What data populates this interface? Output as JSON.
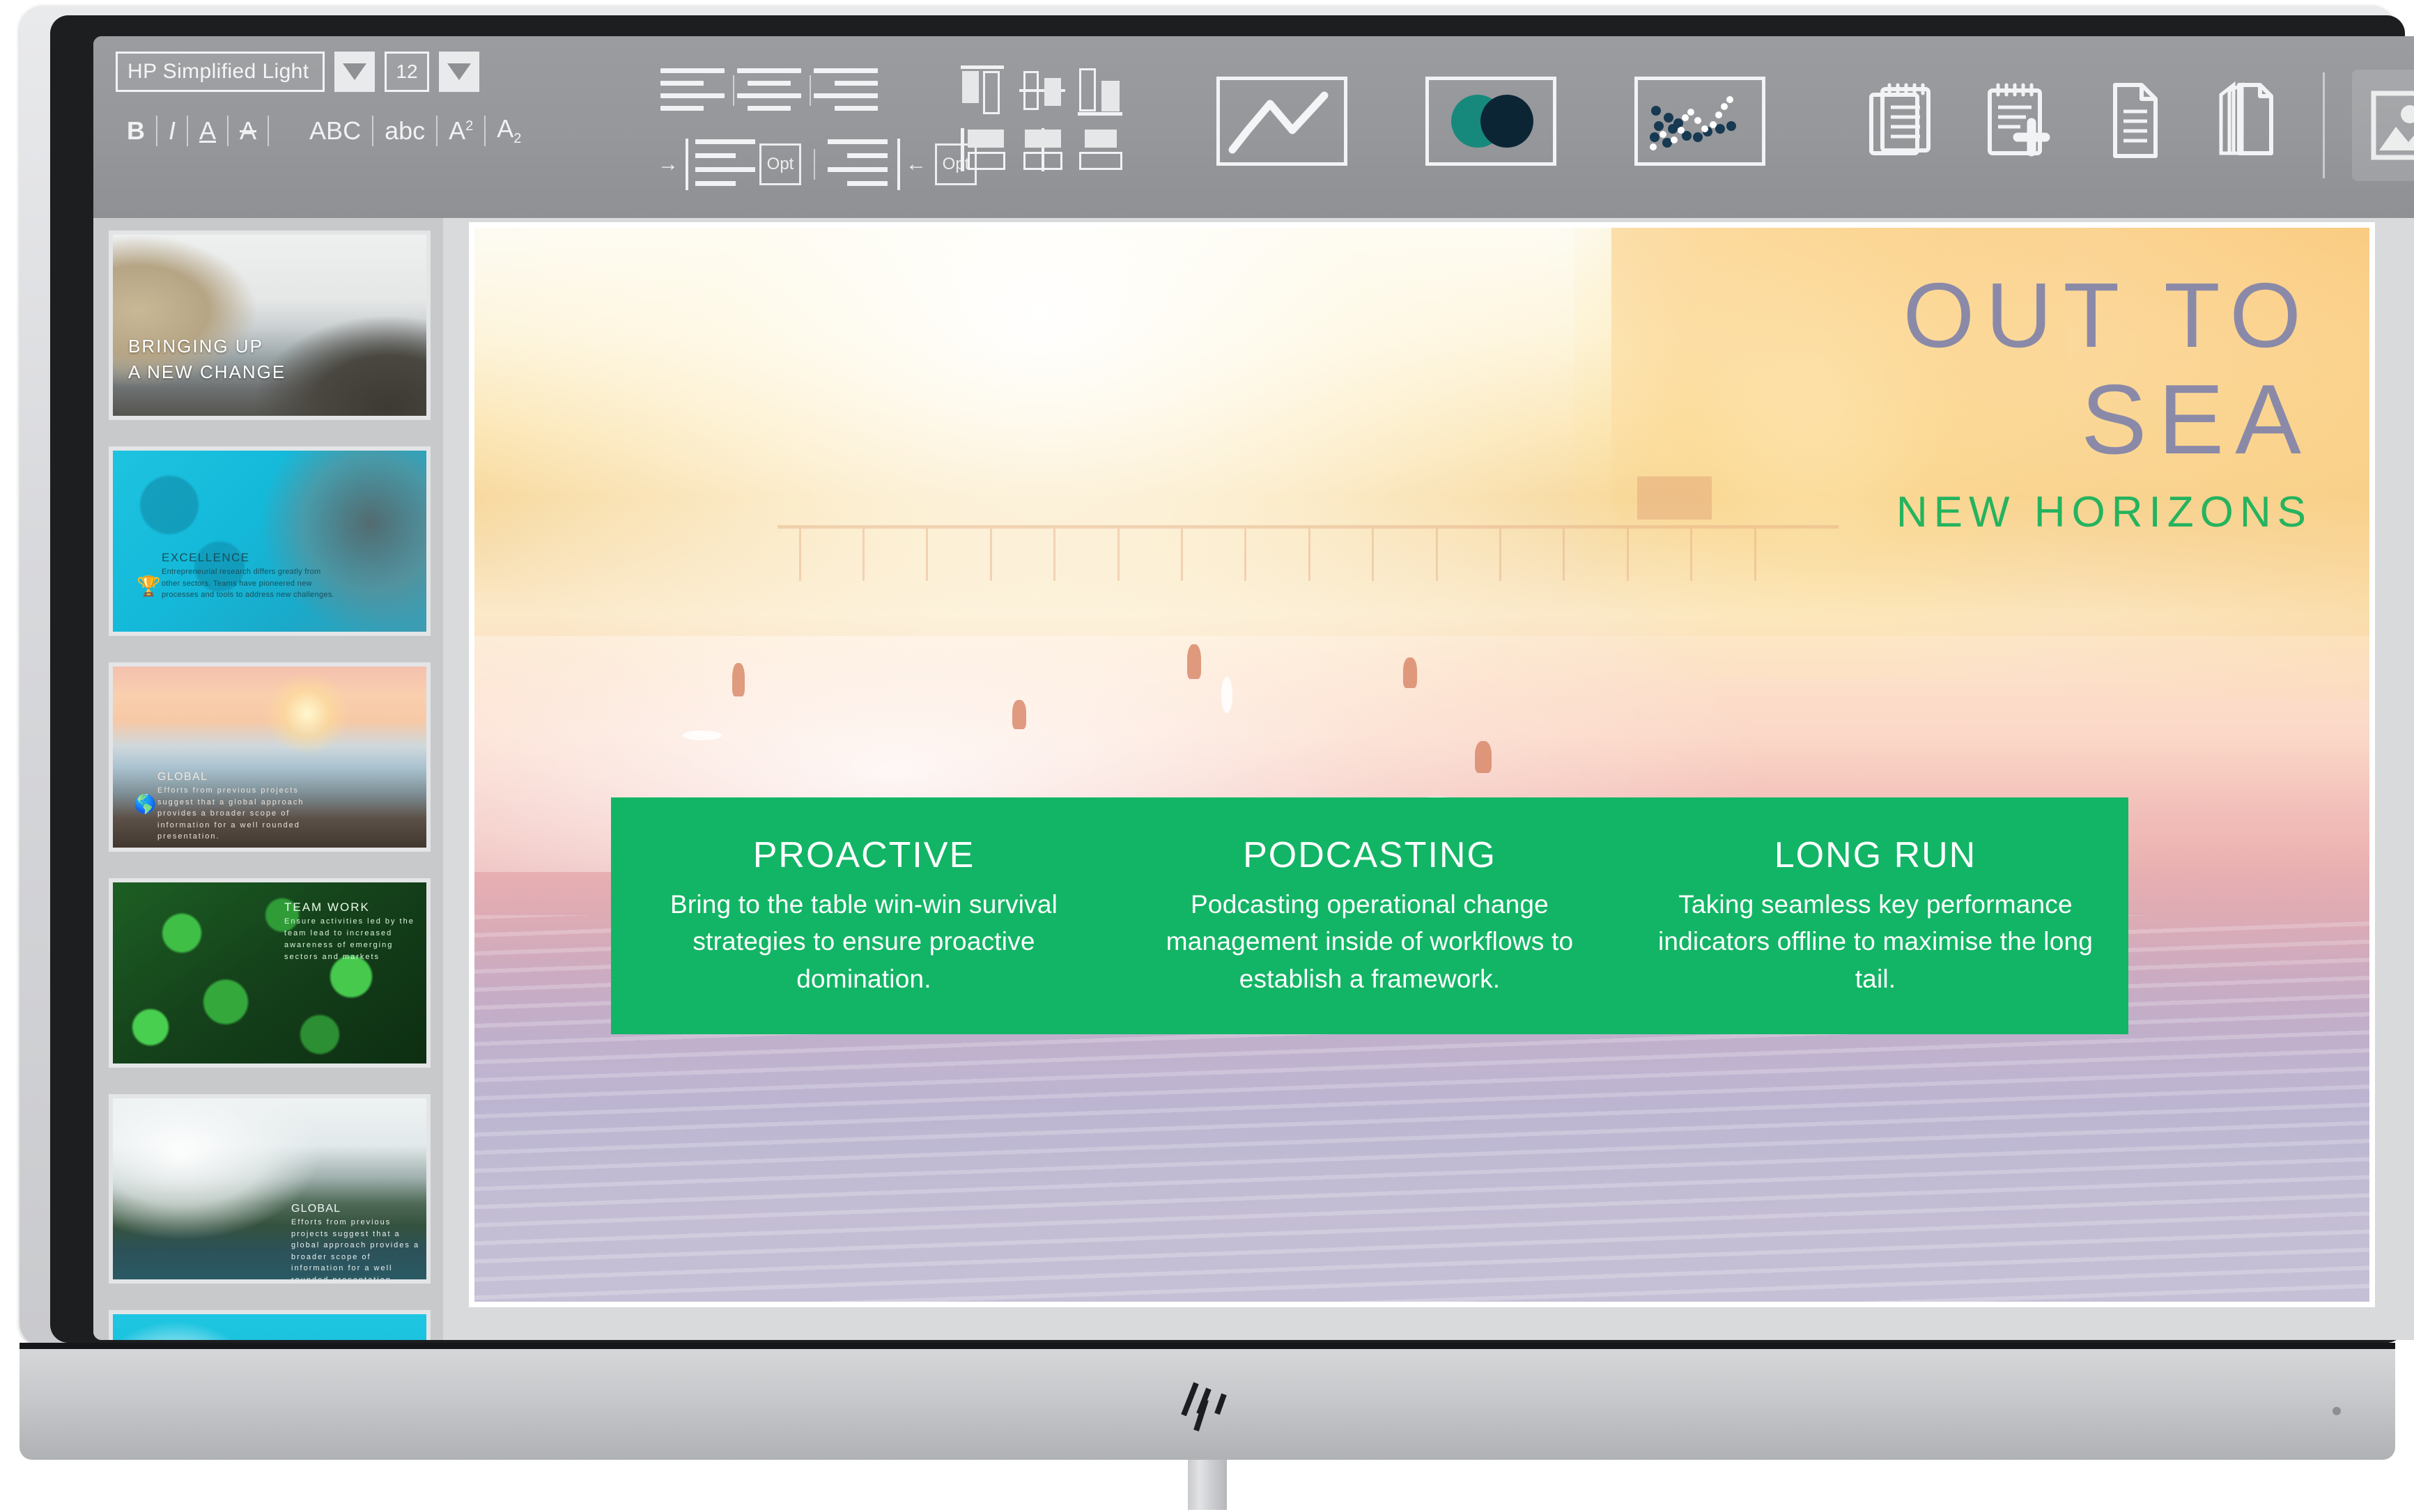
{
  "toolbar": {
    "font": {
      "name_value": "HP Simplified Light",
      "size_value": "12",
      "dropdown_icon": "chevron-down-icon"
    },
    "format_buttons": [
      {
        "label": "B",
        "name": "bold-button"
      },
      {
        "label": "I",
        "name": "italic-button"
      },
      {
        "label": "A",
        "name": "underline-button"
      },
      {
        "label": "A",
        "name": "strikethrough-button"
      },
      {
        "label": "ABC",
        "name": "uppercase-button"
      },
      {
        "label": "abc",
        "name": "lowercase-button"
      },
      {
        "label": "A",
        "sup": "2",
        "name": "superscript-button"
      },
      {
        "label": "A",
        "sub": "2",
        "name": "subscript-button"
      }
    ],
    "paragraph": {
      "align_left": "align-left-icon",
      "align_center": "align-center-icon",
      "align_right": "align-right-icon",
      "indent_increase": "indent-increase-icon",
      "indent_decrease": "indent-decrease-icon",
      "opt_label": "Opt"
    },
    "arrange": {
      "align_top": "align-top-icon",
      "align_middle": "align-middle-icon",
      "align_bottom": "align-bottom-icon",
      "distribute_left": "distribute-left-icon",
      "distribute_center": "distribute-center-icon",
      "distribute_right": "distribute-right-icon"
    },
    "insert_tools": [
      {
        "name": "line-chart-icon",
        "label": "Line chart"
      },
      {
        "name": "venn-circles-icon",
        "label": "Overlapping circles"
      },
      {
        "name": "scatter-plot-icon",
        "label": "Scatter plot"
      }
    ],
    "doc_tools": [
      {
        "name": "notepad-icon",
        "label": "Notes"
      },
      {
        "name": "notepad-add-icon",
        "label": "Add note"
      },
      {
        "name": "document-icon",
        "label": "Document"
      },
      {
        "name": "copy-pages-icon",
        "label": "Duplicate"
      }
    ],
    "image_tool": {
      "name": "image-icon",
      "label": "Insert image",
      "selected": true
    },
    "colors": {
      "toolbar_bg": "#95979b",
      "venn_teal": "#17897c",
      "venn_navy": "#0b2535",
      "scatter_navy": "#173952"
    }
  },
  "sidebar": {
    "slides": [
      {
        "index": 1,
        "caption_line1": "BRINGING UP",
        "caption_line2": "A NEW CHANGE",
        "scene": "coastal-cliff"
      },
      {
        "index": 2,
        "title": "EXCELLENCE",
        "body": "Entrepreneurial research differs greatly from other sectors. Teams have pioneered new processes and tools to address new challenges.",
        "icon": "trophy-icon",
        "scene": "turquoise-reef"
      },
      {
        "index": 3,
        "title": "GLOBAL",
        "body": "Efforts from previous projects suggest that a global approach provides a broader scope of information for a well rounded presentation.",
        "icon": "globe-icon",
        "scene": "sunset-beach"
      },
      {
        "index": 4,
        "title": "TEAM WORK",
        "body": "Ensure activities led by the team lead to increased awareness of emerging sectors and markets",
        "scene": "green-leaves"
      },
      {
        "index": 5,
        "title": "GLOBAL",
        "body": "Efforts from previous projects suggest that a global approach provides a broader scope of information for a well rounded presentation.",
        "scene": "misty-lake"
      },
      {
        "index": 6,
        "title": "",
        "body": "",
        "scene": "wave-splash"
      }
    ]
  },
  "slide": {
    "title_line1": "OUT TO",
    "title_line2": "SEA",
    "subtitle": "NEW HORIZONS",
    "colors": {
      "title": "#8a8aa8",
      "subtitle": "#25b35e",
      "green_bar": "#12b565"
    },
    "columns": [
      {
        "title": "PROACTIVE",
        "body": "Bring to the table win-win survival strategies to ensure proactive domination."
      },
      {
        "title": "PODCASTING",
        "body": "Podcasting operational change management inside of workflows to establish a framework."
      },
      {
        "title": "LONG RUN",
        "body": "Taking seamless key performance indicators offline to maximise the long tail."
      }
    ]
  },
  "hardware": {
    "brand_logo": "hp-logo",
    "power_indicator": "power-led"
  }
}
